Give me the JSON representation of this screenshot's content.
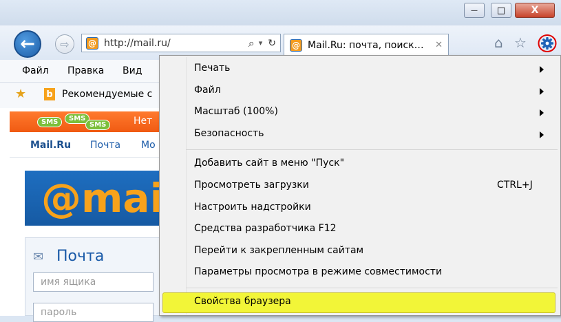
{
  "window": {
    "minimize": "—",
    "maximize": "□",
    "close": "X"
  },
  "nav": {
    "address": "http://mail.ru/",
    "tab_title": "Mail.Ru: почта, поиск…",
    "tab_close": "✕",
    "back_glyph": "←",
    "fwd_glyph": "⇨",
    "search_glyph": "⌕",
    "dropdown_glyph": "▾",
    "refresh_glyph": "↻",
    "favicon": "@"
  },
  "menubar": {
    "items": [
      "Файл",
      "Правка",
      "Вид"
    ]
  },
  "favorites": {
    "suggested": "Рекомендуемые с"
  },
  "page": {
    "sms": [
      "SMS",
      "SMS",
      "SMS"
    ],
    "banner_text": "Нет",
    "nav_links": [
      "Mail.Ru",
      "Почта",
      "Мо"
    ],
    "logo": "@mai",
    "mail_title": "Почта",
    "mailbox_placeholder": "имя ящика",
    "password_placeholder": "пароль"
  },
  "context_menu": {
    "items": [
      {
        "label": "Печать",
        "submenu": true
      },
      {
        "label": "Файл",
        "submenu": true
      },
      {
        "label": "Масштаб (100%)",
        "submenu": true
      },
      {
        "label": "Безопасность",
        "submenu": true
      },
      {
        "label": "Добавить сайт в меню \"Пуск\""
      },
      {
        "label": "Просмотреть загрузки",
        "shortcut": "CTRL+J"
      },
      {
        "label": "Настроить надстройки"
      },
      {
        "label": "Средства разработчика F12"
      },
      {
        "label": "Перейти к закрепленным сайтам"
      },
      {
        "label": "Параметры просмотра в режиме совместимости"
      },
      {
        "label": "Свойства браузера",
        "highlighted": true
      }
    ]
  },
  "colors": {
    "accent_highlight": "#f2f538",
    "gear_circle": "#e00000",
    "brand_orange": "#f05a12"
  }
}
